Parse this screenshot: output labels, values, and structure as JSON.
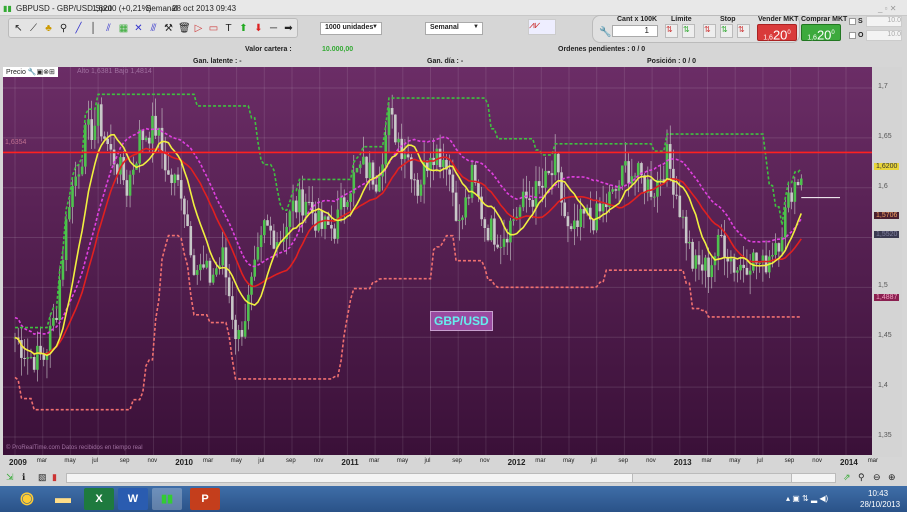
{
  "window": {
    "title": "GBPUSD - GBP/USD Spot",
    "change": "1,6200 (+0,21%)",
    "period": "Semanal",
    "datetime": "28 oct 2013 09:43"
  },
  "toolbar": {
    "units_select": "1000 unidades",
    "period_select": "Semanal"
  },
  "order": {
    "qty_label": "Cant x 100K",
    "qty_value": "1",
    "limit_label": "Límite",
    "stop_label": "Stop",
    "sell_label": "Vender MKT",
    "buy_label": "Comprar MKT",
    "sell_prefix": "1,6",
    "sell_price": "20",
    "sell_sup": "0",
    "buy_prefix": "1,6",
    "buy_price": "20",
    "buy_sup": "0",
    "s_label": "S",
    "o_label": "O",
    "s_value": "10.0",
    "o_value": "10.0"
  },
  "info": {
    "valor_label": "Valor cartera :",
    "valor_value": "10.000,00",
    "ordenes": "Ordenes pendientes : 0  / 0",
    "latente": "Gan. latente : -",
    "dia": "Gan. día : -",
    "posicion": "Posición : 0  / 0"
  },
  "chart_header": {
    "label": "Precio",
    "ohlc": "Alto 1,6381  Bajo 1,4814"
  },
  "watermark": "GBP/USD",
  "footer_note": "© ProRealTime.com  Datos recibidos en tiempo real",
  "ref_line_label": "1,6354",
  "price_tags": [
    {
      "text": "1,6200",
      "value": 1.62,
      "bg": "#e8d43a",
      "fg": "#333"
    },
    {
      "text": "1,5706",
      "value": 1.5706,
      "bg": "#4a2030",
      "fg": "#f0a060"
    },
    {
      "text": "1,5520",
      "value": 1.552,
      "bg": "#3a3a50",
      "fg": "#8080a0"
    },
    {
      "text": "1,4887",
      "value": 1.4887,
      "bg": "#8a2050",
      "fg": "#f0a0c0"
    }
  ],
  "taskbar": {
    "time": "10:43",
    "date": "28/10/2013"
  },
  "chart_data": {
    "type": "candlestick",
    "symbol": "GBP/USD",
    "interval": "weekly",
    "ylim": [
      1.33,
      1.72
    ],
    "yticks": [
      1.35,
      1.4,
      1.45,
      1.5,
      1.55,
      1.6,
      1.65,
      1.7
    ],
    "ytick_labels": [
      "1,35",
      "1,4",
      "1,45",
      "1,5",
      "",
      "1,6",
      "1,65",
      "1,7"
    ],
    "xtick_labels": [
      "2009",
      "mar",
      "may",
      "jul",
      "sep",
      "nov",
      "2010",
      "mar",
      "may",
      "jul",
      "sep",
      "nov",
      "2011",
      "mar",
      "may",
      "jul",
      "sep",
      "nov",
      "2012",
      "mar",
      "may",
      "jul",
      "sep",
      "nov",
      "2013",
      "mar",
      "may",
      "jul",
      "sep",
      "nov",
      "2014",
      "mar"
    ],
    "monthly_close": [
      1.45,
      1.43,
      1.43,
      1.48,
      1.6,
      1.65,
      1.67,
      1.63,
      1.6,
      1.65,
      1.66,
      1.61,
      1.6,
      1.52,
      1.51,
      1.53,
      1.45,
      1.5,
      1.56,
      1.55,
      1.58,
      1.59,
      1.56,
      1.56,
      1.6,
      1.62,
      1.61,
      1.67,
      1.64,
      1.6,
      1.64,
      1.63,
      1.56,
      1.61,
      1.56,
      1.55,
      1.57,
      1.59,
      1.6,
      1.62,
      1.55,
      1.57,
      1.57,
      1.59,
      1.62,
      1.61,
      1.6,
      1.63,
      1.58,
      1.52,
      1.52,
      1.55,
      1.52,
      1.53,
      1.52,
      1.55,
      1.6,
      1.62
    ],
    "reference_line": 1.6354,
    "last_price": 1.62
  }
}
